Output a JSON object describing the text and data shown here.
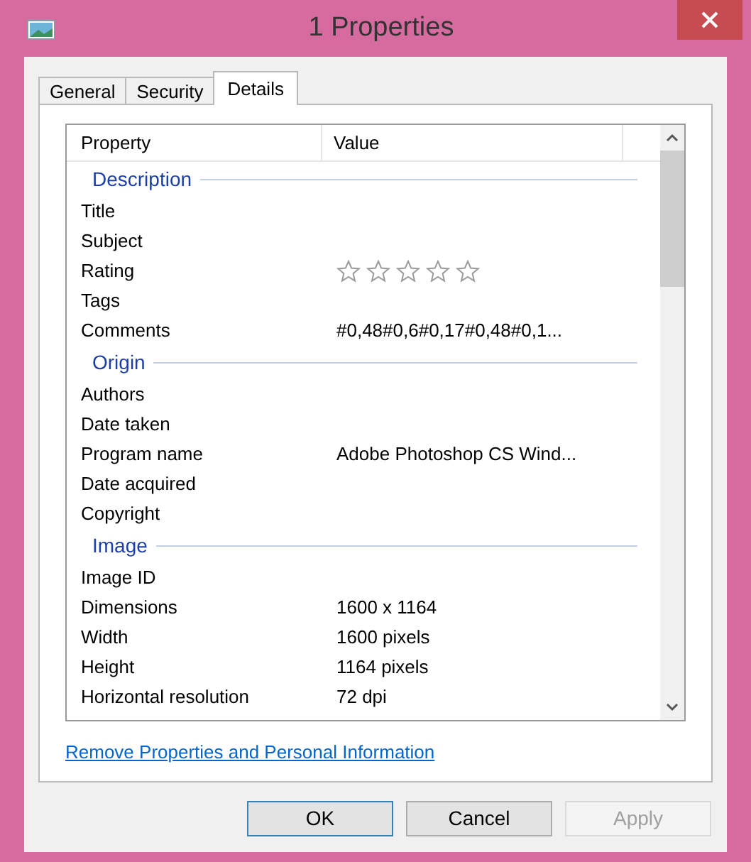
{
  "window": {
    "title": "1 Properties"
  },
  "tabs": [
    {
      "label": "General",
      "selected": false
    },
    {
      "label": "Security",
      "selected": false
    },
    {
      "label": "Details",
      "selected": true
    }
  ],
  "table": {
    "columns": [
      "Property",
      "Value"
    ],
    "groups": [
      {
        "heading": "Description",
        "rows": [
          {
            "kind": "text",
            "property": "Title"
          },
          {
            "kind": "text",
            "property": "Subject"
          },
          {
            "kind": "rating",
            "property": "Rating",
            "stars": 0
          },
          {
            "kind": "text",
            "property": "Tags"
          },
          {
            "kind": "text",
            "property": "Comments",
            "value": "#0,48#0,6#0,17#0,48#0,1..."
          }
        ]
      },
      {
        "heading": "Origin",
        "rows": [
          {
            "kind": "text",
            "property": "Authors"
          },
          {
            "kind": "text",
            "property": "Date taken"
          },
          {
            "kind": "text",
            "property": "Program name",
            "value": "Adobe Photoshop CS Wind..."
          },
          {
            "kind": "text",
            "property": "Date acquired"
          },
          {
            "kind": "text",
            "property": "Copyright"
          }
        ]
      },
      {
        "heading": "Image",
        "rows": [
          {
            "kind": "text",
            "property": "Image ID"
          },
          {
            "kind": "text",
            "property": "Dimensions",
            "value": "1600 x 1164"
          },
          {
            "kind": "text",
            "property": "Width",
            "value": "1600 pixels"
          },
          {
            "kind": "text",
            "property": "Height",
            "value": "1164 pixels"
          },
          {
            "kind": "text",
            "property": "Horizontal resolution",
            "value": "72 dpi"
          }
        ]
      }
    ]
  },
  "link": "Remove Properties and Personal Information",
  "buttons": [
    {
      "label": "OK",
      "disabled": false,
      "default": true
    },
    {
      "label": "Cancel",
      "disabled": false,
      "default": false
    },
    {
      "label": "Apply",
      "disabled": true,
      "default": false
    }
  ]
}
